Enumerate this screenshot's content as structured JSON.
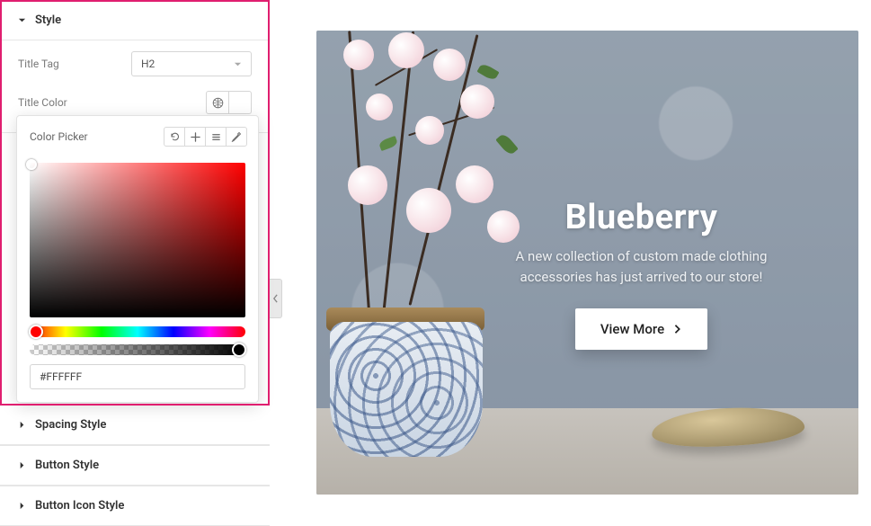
{
  "sections": {
    "style": "Style",
    "spacing": "Spacing Style",
    "button": "Button Style",
    "button_icon": "Button Icon Style"
  },
  "style": {
    "title_tag_label": "Title Tag",
    "title_tag_value": "H2",
    "title_color_label": "Title Color"
  },
  "picker": {
    "title": "Color Picker",
    "hex_value": "#FFFFFF"
  },
  "preview": {
    "hero_title": "Blueberry",
    "hero_sub_l1": "A new collection of custom made clothing",
    "hero_sub_l2": "accessories has just arrived to our store!",
    "button_label": "View More"
  }
}
